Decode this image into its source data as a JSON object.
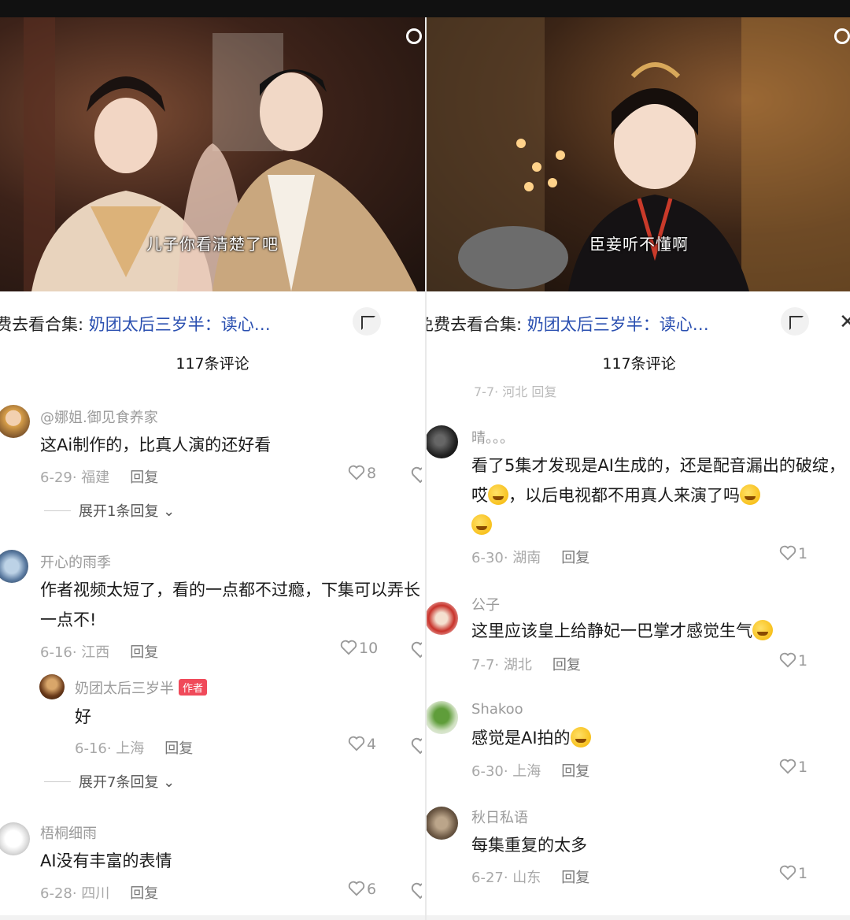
{
  "left": {
    "subtitle": "儿子你看清楚了吧",
    "collection_prefix": "费去看合集:",
    "collection_link": "奶团太后三岁半：读心…",
    "comment_count": "117条评论",
    "comments": [
      {
        "name": "@娜姐.御见食养家",
        "text": "这Ai制作的，比真人演的还好看",
        "date": "6-29· 福建",
        "reply": "回复",
        "likes": "8",
        "more": "展开1条回复"
      },
      {
        "name": "开心的雨季",
        "text": "作者视频太短了，看的一点都不过瘾，下集可以弄长一点不!",
        "date": "6-16· 江西",
        "reply": "回复",
        "likes": "10"
      },
      {
        "name": "奶团太后三岁半",
        "badge": "作者",
        "text": "好",
        "date": "6-16· 上海",
        "reply": "回复",
        "likes": "4",
        "more": "展开7条回复"
      },
      {
        "name": "梧桐细雨",
        "text": "AI没有丰富的表情",
        "date": "6-28· 四川",
        "reply": "回复",
        "likes": "6"
      }
    ]
  },
  "right": {
    "subtitle": "臣妾听不懂啊",
    "collection_prefix": "免费去看合集:",
    "collection_link": "奶团太后三岁半：读心…",
    "comment_count": "117条评论",
    "clipped_top": "7-7· 河北   回复",
    "comments": [
      {
        "name": "晴。。。",
        "text": "看了5集才发现是AI生成的，还是配音漏出的破绽，哎",
        "text2": "，以后电视都不用真人来演了吗",
        "date": "6-30· 湖南",
        "reply": "回复",
        "likes": "1"
      },
      {
        "name": "公子",
        "text": "这里应该皇上给静妃一巴掌才感觉生气",
        "date": "7-7· 湖北",
        "reply": "回复",
        "likes": "1"
      },
      {
        "name": "Shakoo",
        "text": "感觉是AI拍的",
        "date": "6-30· 上海",
        "reply": "回复",
        "likes": "1"
      },
      {
        "name": "秋日私语",
        "text": "每集重复的太多",
        "date": "6-27· 山东",
        "reply": "回复",
        "likes": "1"
      }
    ]
  },
  "colors": {
    "link": "#2a4fb0",
    "badge": "#f04a5a"
  }
}
